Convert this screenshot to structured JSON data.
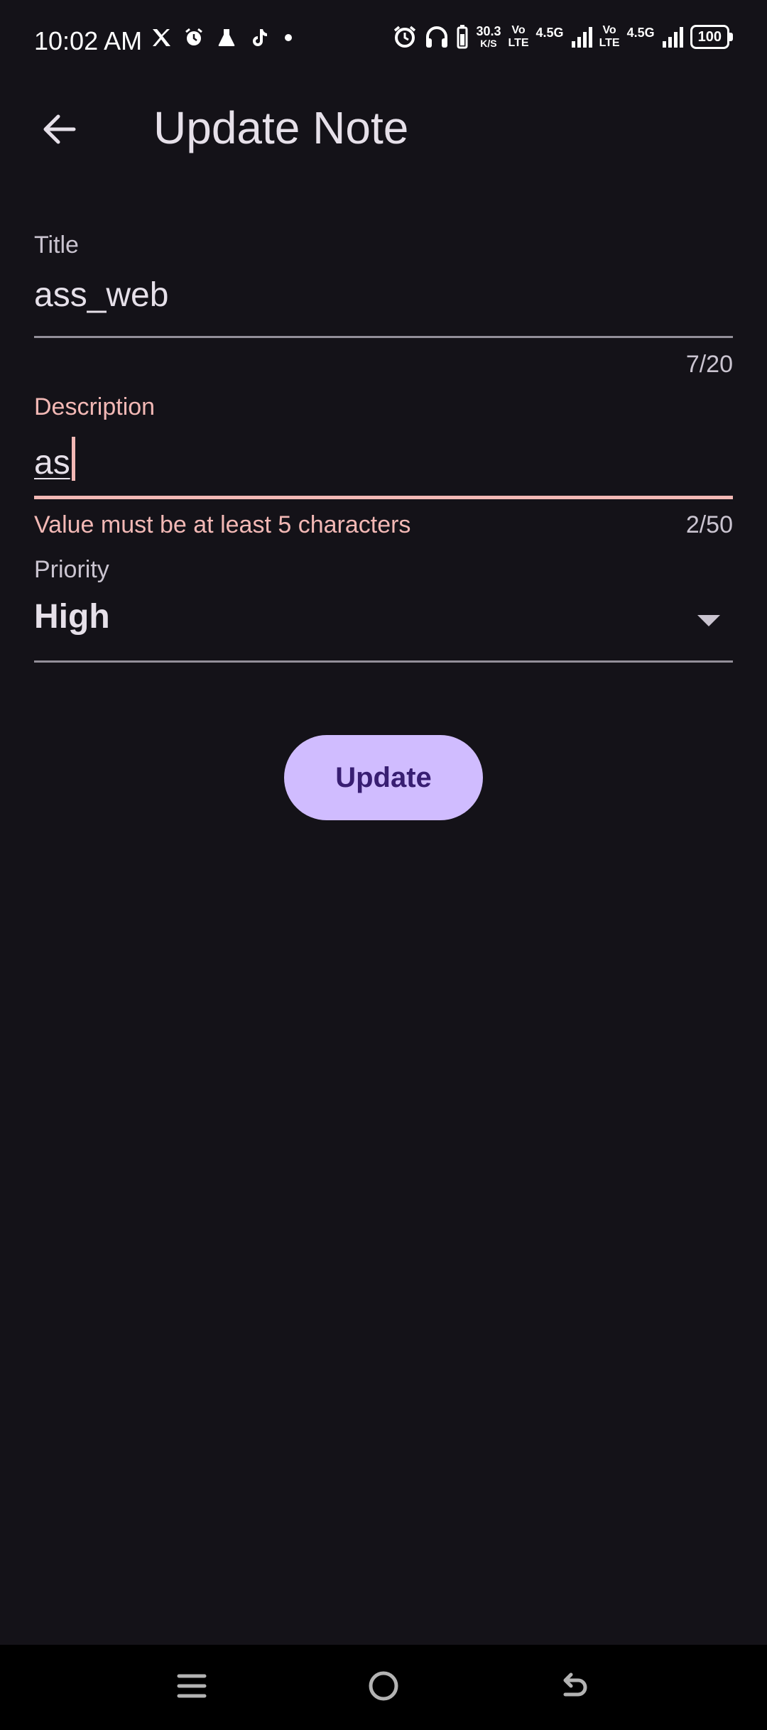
{
  "status_bar": {
    "time": "10:02 AM",
    "net_speed_value": "30.3",
    "net_speed_unit": "K/S",
    "volte_top": "Vo",
    "volte_bottom": "LTE",
    "net_type": "4.5G",
    "battery": "100",
    "icons": [
      "x-icon",
      "alarm-icon",
      "flask-icon",
      "tiktok-icon",
      "dot-icon",
      "alarm-icon",
      "headphones-icon",
      "battery-saver-icon",
      "signal-icon"
    ]
  },
  "app_bar": {
    "title": "Update Note",
    "back_icon": "arrow-left-icon"
  },
  "form": {
    "title_field": {
      "label": "Title",
      "value": "ass_web",
      "counter": "7/20"
    },
    "description_field": {
      "label": "Description",
      "value": "as",
      "counter": "2/50",
      "error": "Value must be at least 5 characters"
    },
    "priority_field": {
      "label": "Priority",
      "value": "High",
      "arrow_icon": "dropdown-arrow-icon"
    },
    "update_button": "Update"
  },
  "nav_bar": {
    "icons": [
      "menu-icon",
      "home-icon",
      "back-icon"
    ]
  },
  "colors": {
    "background": "#141218",
    "primary": "#d0bcff",
    "on_primary": "#381e72",
    "error": "#f2b8b5"
  }
}
